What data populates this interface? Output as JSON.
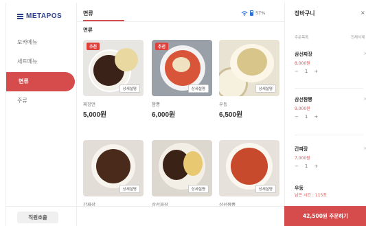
{
  "app": {
    "logo": "METAPOS"
  },
  "sidebar": {
    "items": [
      {
        "label": "모카메뉴"
      },
      {
        "label": "세트메뉴"
      },
      {
        "label": "면류"
      },
      {
        "label": "주류"
      }
    ],
    "call_staff": "직원호출"
  },
  "header": {
    "tab": "면류",
    "section": "면류",
    "battery": "57%"
  },
  "menu": {
    "badge": "추천",
    "detail": "상세설명",
    "items": [
      {
        "name": "짜장면",
        "price": "5,000원"
      },
      {
        "name": "짬뽕",
        "price": "6,000원"
      },
      {
        "name": "우동",
        "price": "6,500원"
      },
      {
        "name": "간짜장",
        "price": ""
      },
      {
        "name": "삼선짜장",
        "price": ""
      },
      {
        "name": "삼선짬뽕",
        "price": ""
      }
    ]
  },
  "cart": {
    "title": "장바구니",
    "close": "×",
    "sub_left": "주문목록",
    "sub_right": "전체삭제",
    "items": [
      {
        "name": "삼선짜장",
        "price": "8,000원",
        "qty": "1"
      },
      {
        "name": "삼선짬뽕",
        "price": "9,000원",
        "qty": "1"
      },
      {
        "name": "간짜장",
        "price": "7,000원",
        "qty": "1"
      },
      {
        "name": "우동",
        "price": "",
        "qty": ""
      }
    ],
    "remaining": "남은 시간 : 115초",
    "order_button": "42,500원 주문하기"
  },
  "colors": {
    "accent": "#d64b4b",
    "brand": "#2c3e8f",
    "price": "#e05050"
  },
  "icons": {
    "wifi": "wifi-icon",
    "battery": "battery-icon",
    "minus": "minus-icon",
    "plus": "plus-icon",
    "close": "close-icon",
    "remove": "remove-item-icon"
  }
}
